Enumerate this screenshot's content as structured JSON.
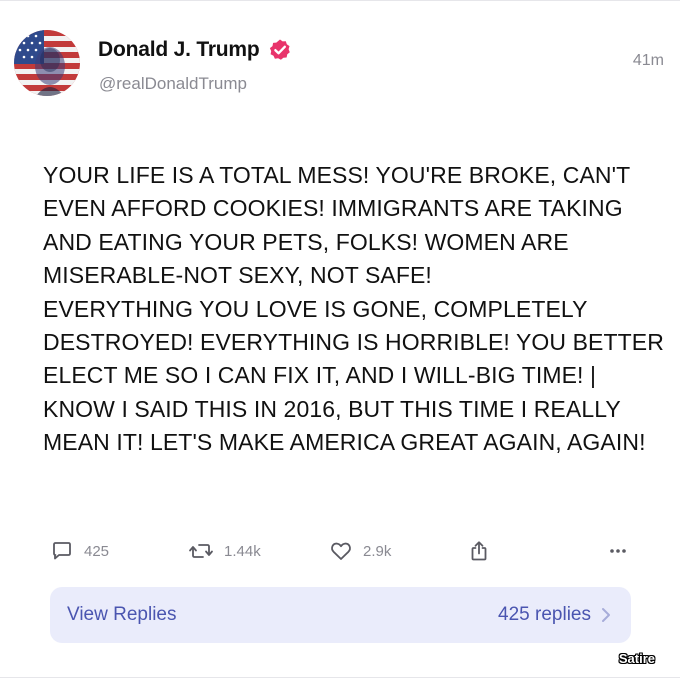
{
  "post": {
    "author": {
      "display_name": "Donald J. Trump",
      "handle": "@realDonaldTrump",
      "verified": true,
      "avatar_icon": "flag-portrait-avatar"
    },
    "time_ago": "41m",
    "body": "YOUR LIFE IS A TOTAL MESS! YOU'RE BROKE, CAN'T\nEVEN AFFORD COOKIES! IMMIGRANTS ARE TAKING\nAND EATING YOUR PETS, FOLKS! WOMEN ARE\nMISERABLE-NOT SEXY, NOT SAFE!\nEVERYTHING YOU LOVE IS GONE, COMPLETELY\nDESTROYED! EVERYTHING IS HORRIBLE! YOU BETTER\nELECT ME SO I CAN FIX IT, AND I WILL-BIG TIME! |\nKNOW I SAID THIS IN 2016, BUT THIS TIME I REALLY\nMEAN IT! LET'S MAKE AMERICA GREAT AGAIN, AGAIN!"
  },
  "actions": {
    "replies": {
      "count": "425",
      "icon": "comment-icon"
    },
    "reposts": {
      "count": "1.44k",
      "icon": "repost-icon"
    },
    "likes": {
      "count": "2.9k",
      "icon": "heart-icon"
    },
    "share": {
      "icon": "share-icon"
    },
    "more": {
      "icon": "more-icon"
    }
  },
  "replies_bar": {
    "label": "View Replies",
    "count_text": "425 replies"
  },
  "watermark": "Satire",
  "colors": {
    "accent": "#4a55b0",
    "replies_bg": "#eaecfb",
    "muted": "#8a8a92",
    "verified_badge": "#e8346b"
  }
}
